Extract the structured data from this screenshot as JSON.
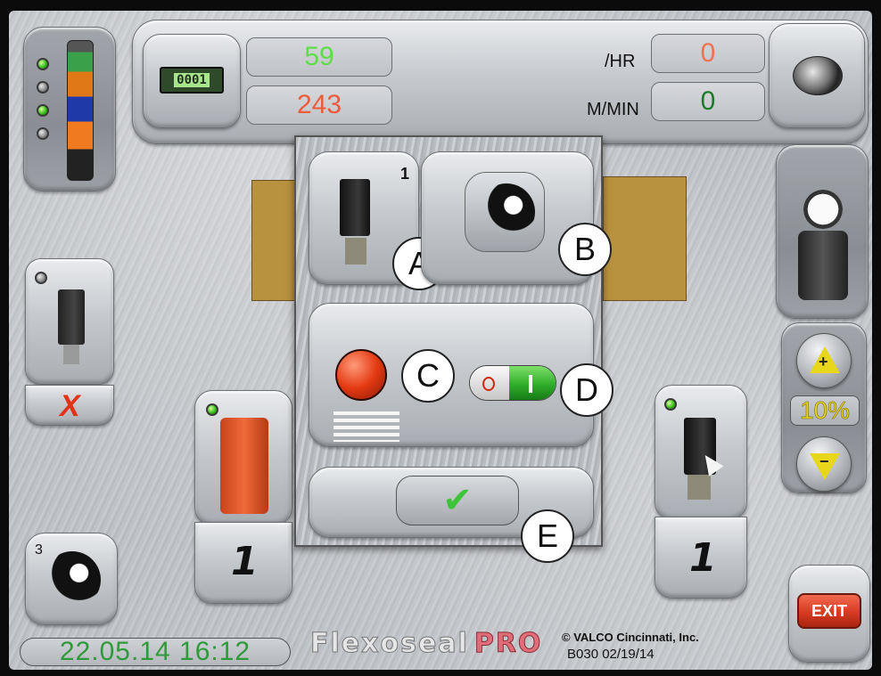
{
  "header": {
    "counter_icon_text": "0001",
    "count_top": "59",
    "count_bottom": "243",
    "rate_hr_label": "/HR",
    "rate_hr_value": "0",
    "speed_label": "M/MIN",
    "speed_value": "0"
  },
  "left": {
    "valve_status": "X",
    "wrench_badge": "3"
  },
  "dialog": {
    "valve_number": "1",
    "callouts": [
      "A",
      "B",
      "C",
      "D",
      "E"
    ]
  },
  "valves": {
    "left_count": "1",
    "right_count": "1"
  },
  "right": {
    "pressure_percent": "10%",
    "plus_label": "+",
    "minus_label": "−",
    "exit_label": "EXIT"
  },
  "footer": {
    "datetime": "22.05.14 16:12",
    "brand": "Flexoseal",
    "brand_pro": "PRO",
    "copyright": "© VALCO Cincinnati, Inc.",
    "version": "B030 02/19/14"
  },
  "colors": {
    "count_top": "#5fdc4a",
    "count_bottom": "#ee5a3a",
    "rate_hr": "#f07050",
    "speed": "#1d7a2a",
    "datetime": "#2f9a3a",
    "exit": "#d83a22"
  }
}
